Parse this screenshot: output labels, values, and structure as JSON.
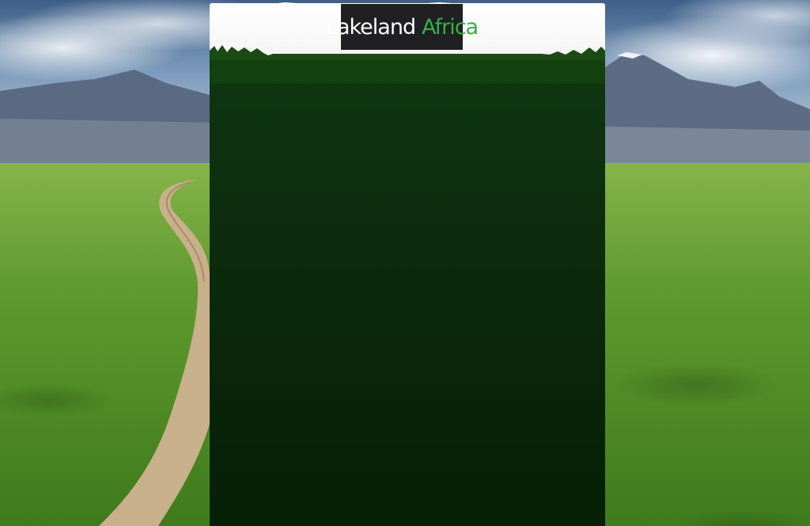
{
  "site": {
    "logo_word1": "Lakeland",
    "logo_word2": "Africa"
  },
  "colors": {
    "logo_bg": "#201f21",
    "logo_accent": "#2fb24a",
    "panel_top": "#0f3511",
    "panel_bottom": "#061f05"
  },
  "images": {
    "background": "savanna-landscape-with-dirt-road-and-mountains"
  }
}
